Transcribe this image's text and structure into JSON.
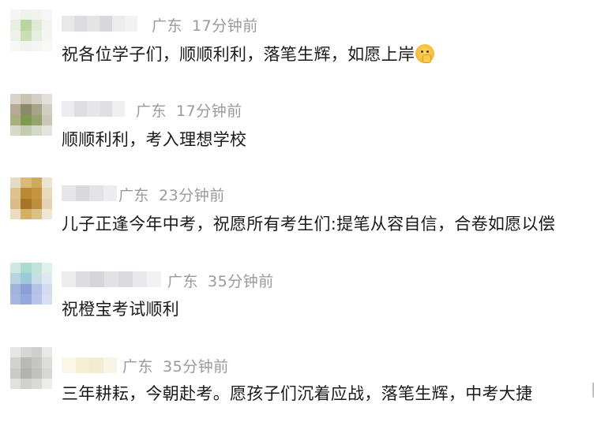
{
  "comments": [
    {
      "location": "广东",
      "time": "17分钟前",
      "text": "祝各位学子们，顺顺利利，落笔生辉，如愿上岸",
      "emoji": "shushing-face-emoji"
    },
    {
      "location": "广东",
      "time": "17分钟前",
      "text": "顺顺利利，考入理想学校"
    },
    {
      "location": "广东",
      "time": "23分钟前",
      "text": "儿子正逢今年中考，祝愿所有考生们:提笔从容自信，合卷如愿以偿"
    },
    {
      "location": "广东",
      "time": "35分钟前",
      "text": "祝橙宝考试顺利"
    },
    {
      "location": "广东",
      "time": "35分钟前",
      "text": "三年耕耘，今朝赴考。愿孩子们沉着应战，落笔生辉，中考大捷"
    }
  ],
  "colors": {
    "meta_text": "#9a9a9a",
    "body_text": "#1a1a1a",
    "background": "#ffffff"
  }
}
